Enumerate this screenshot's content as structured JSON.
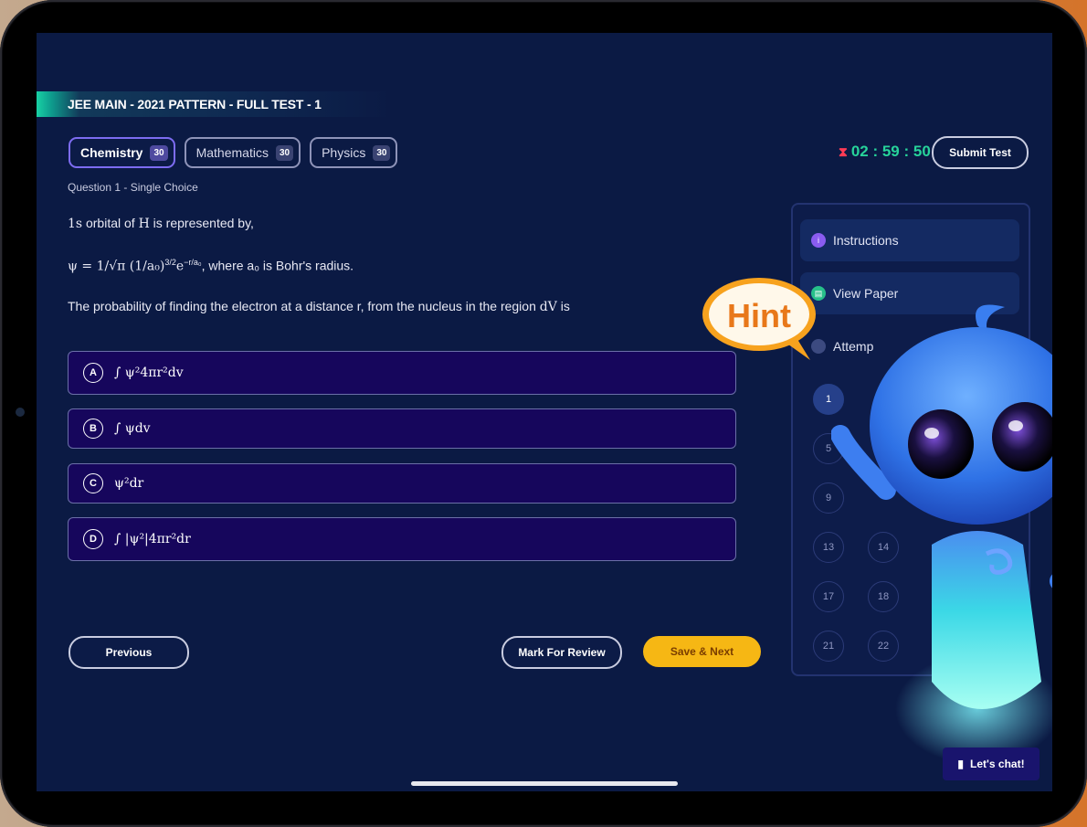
{
  "test": {
    "title": "JEE MAIN - 2021 PATTERN - FULL TEST - 1"
  },
  "subjects": [
    {
      "name": "Chemistry",
      "count": "30",
      "active": true
    },
    {
      "name": "Mathematics",
      "count": "30",
      "active": false
    },
    {
      "name": "Physics",
      "count": "30",
      "active": false
    }
  ],
  "timer": {
    "value": "02 : 59 : 50",
    "icon": "hourglass-icon"
  },
  "submit_label": "Submit Test",
  "question": {
    "meta": "Question 1 - Single Choice",
    "line1_orbital": "1s",
    "line1_text": " orbital of ",
    "line1_atom": "H",
    "line1_end": " is represented by,",
    "line2_formula": "ψ = 1/√π (1/a₀)",
    "line2_exp": "3/2",
    "line2_e": "e",
    "line2_eexp": "−r/a₀",
    "line2_text": ", where a₀ is Bohr's radius.",
    "line3_text": "The probability of finding the electron at a distance r, from the nucleus in the region",
    "line3_dv": "dV",
    "line3_end": " is"
  },
  "options": [
    {
      "letter": "A",
      "text": "∫ ψ²4πr²dv"
    },
    {
      "letter": "B",
      "text": "∫ ψdv"
    },
    {
      "letter": "C",
      "text": "ψ²dr"
    },
    {
      "letter": "D",
      "text": "∫ |ψ²|4πr²dr"
    }
  ],
  "buttons": {
    "previous": "Previous",
    "mark": "Mark For Review",
    "save_next": "Save & Next"
  },
  "panel": {
    "instructions": "Instructions",
    "view_paper": "View Paper",
    "attempts": "Attemp",
    "numbers": [
      "1",
      "5",
      "9",
      "13",
      "17",
      "21",
      "14",
      "18",
      "22"
    ]
  },
  "hint_label": "Hint",
  "chat_label": "Let's chat!",
  "colors": {
    "accent": "#7d6cf1",
    "timer": "#27d39a",
    "save": "#f6b714",
    "option_bg": "#16065c"
  }
}
